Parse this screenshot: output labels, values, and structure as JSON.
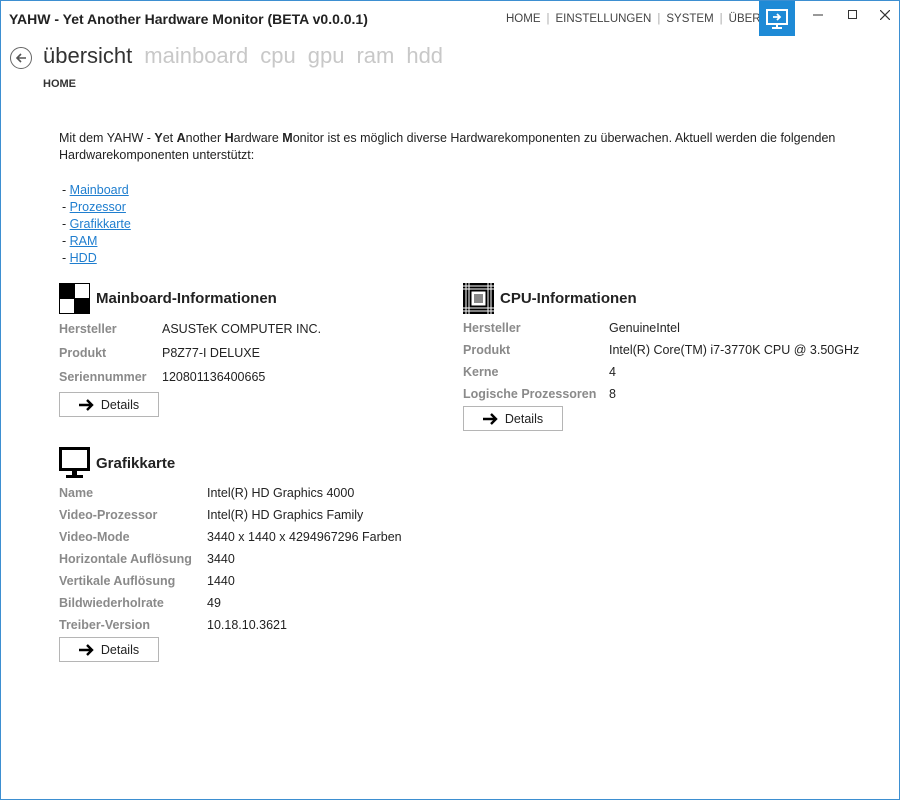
{
  "window": {
    "title": "YAHW - Yet Another Hardware Monitor (BETA v0.0.0.1)",
    "nav": [
      "HOME",
      "EINSTELLUNGEN",
      "SYSTEM",
      "ÜBER"
    ],
    "accent": "#1e8ad6"
  },
  "pivot": {
    "items": [
      "übersicht",
      "mainboard",
      "cpu",
      "gpu",
      "ram",
      "hdd"
    ],
    "breadcrumb": "HOME"
  },
  "intro": {
    "text_prefix": "Mit dem YAHW - ",
    "y": "Y",
    "et": "et ",
    "a": "A",
    "nother": "nother ",
    "h": "H",
    "ardware": "ardware ",
    "m": "M",
    "onitor": "onitor",
    "text_suffix": " ist es möglich diverse Hardwarekomponenten zu überwachen. Aktuell werden die folgenden Hardwarekomponenten unterstützt:",
    "bullet": "-",
    "links": [
      "Mainboard",
      "Prozessor",
      "Grafikkarte",
      "RAM",
      "HDD"
    ]
  },
  "mainboard": {
    "heading": "Mainboard-Informationen",
    "rows": [
      {
        "label": "Hersteller",
        "value": "ASUSTeK COMPUTER INC."
      },
      {
        "label": "Produkt",
        "value": "P8Z77-I DELUXE"
      },
      {
        "label": "Seriennummer",
        "value": "120801136400665"
      }
    ],
    "button": "Details"
  },
  "cpu": {
    "heading": "CPU-Informationen",
    "rows": [
      {
        "label": "Hersteller",
        "value": "GenuineIntel"
      },
      {
        "label": "Produkt",
        "value": "Intel(R) Core(TM) i7-3770K CPU @ 3.50GHz"
      },
      {
        "label": "Kerne",
        "value": "4"
      },
      {
        "label": "Logische Prozessoren",
        "value": "8"
      }
    ],
    "button": "Details"
  },
  "gpu": {
    "heading": "Grafikkarte",
    "rows": [
      {
        "label": "Name",
        "value": "Intel(R) HD Graphics 4000"
      },
      {
        "label": "Video-Prozessor",
        "value": "Intel(R) HD Graphics Family"
      },
      {
        "label": "Video-Mode",
        "value": "3440 x 1440 x 4294967296 Farben"
      },
      {
        "label": "Horizontale Auflösung",
        "value": "3440"
      },
      {
        "label": "Vertikale Auflösung",
        "value": "1440"
      },
      {
        "label": "Bildwiederholrate",
        "value": "49"
      },
      {
        "label": "Treiber-Version",
        "value": "10.18.10.3621"
      }
    ],
    "button": "Details"
  }
}
